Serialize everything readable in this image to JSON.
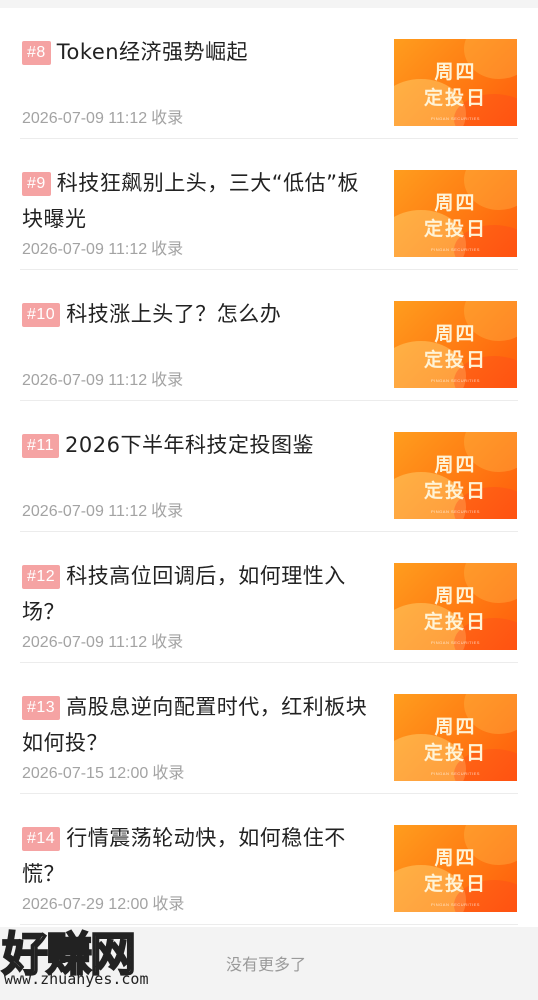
{
  "articles": [
    {
      "badge": "#8",
      "title": "Token经济强势崛起",
      "date": "2026-07-09 11:12",
      "collect": "收录",
      "thumb": {
        "line1": "周四",
        "line2": "定投日",
        "brand": "PINGAN SECURITIES"
      }
    },
    {
      "badge": "#9",
      "title": "科技狂飙别上头，三大“低估”板块曝光",
      "date": "2026-07-09 11:12",
      "collect": "收录",
      "thumb": {
        "line1": "周四",
        "line2": "定投日",
        "brand": "PINGAN SECURITIES"
      }
    },
    {
      "badge": "#10",
      "title": "科技涨上头了？怎么办",
      "date": "2026-07-09 11:12",
      "collect": "收录",
      "thumb": {
        "line1": "周四",
        "line2": "定投日",
        "brand": "PINGAN SECURITIES"
      }
    },
    {
      "badge": "#11",
      "title": "2026下半年科技定投图鉴",
      "date": "2026-07-09 11:12",
      "collect": "收录",
      "thumb": {
        "line1": "周四",
        "line2": "定投日",
        "brand": "PINGAN SECURITIES"
      }
    },
    {
      "badge": "#12",
      "title": "科技高位回调后，如何理性入场？",
      "date": "2026-07-09 11:12",
      "collect": "收录",
      "thumb": {
        "line1": "周四",
        "line2": "定投日",
        "brand": "PINGAN SECURITIES"
      }
    },
    {
      "badge": "#13",
      "title": "高股息逆向配置时代，红利板块如何投？",
      "date": "2026-07-15 12:00",
      "collect": "收录",
      "thumb": {
        "line1": "周四",
        "line2": "定投日",
        "brand": "PINGAN SECURITIES"
      }
    },
    {
      "badge": "#14",
      "title": "行情震荡轮动快，如何稳住不慌？",
      "date": "2026-07-29 12:00",
      "collect": "收录",
      "thumb": {
        "line1": "周四",
        "line2": "定投日",
        "brand": "PINGAN SECURITIES"
      }
    }
  ],
  "footer": {
    "end_text": "没有更多了"
  },
  "watermark": {
    "logo": "好赚网",
    "url": "www.zhuanyes.com"
  },
  "colors": {
    "badge_bg": "#f5a3a3",
    "thumb_orange": "#ff7a12",
    "meta_gray": "#a3a3a3"
  }
}
